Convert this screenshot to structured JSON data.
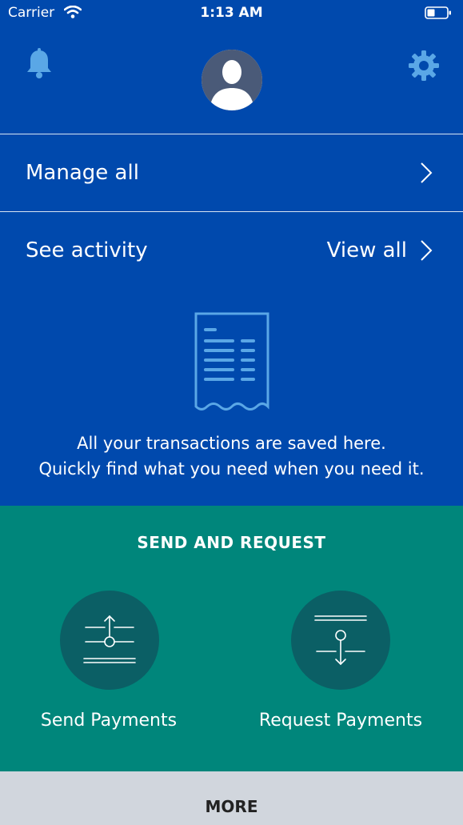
{
  "status_bar": {
    "carrier": "Carrier",
    "time": "1:13 AM"
  },
  "header": {
    "icons": [
      "bell-icon",
      "avatar",
      "gear-icon"
    ]
  },
  "rows": {
    "manage": {
      "label": "Manage all"
    },
    "activity": {
      "label": "See activity",
      "link": "View all"
    }
  },
  "empty_state": {
    "line1": "All your transactions are saved here.",
    "line2": "Quickly find what you need when you need it."
  },
  "send_request": {
    "title": "SEND AND REQUEST",
    "send_label": "Send Payments",
    "request_label": "Request Payments"
  },
  "more": {
    "label": "MORE"
  },
  "colors": {
    "primary_blue": "#0049ad",
    "teal": "#00867b",
    "circle": "#0b5f65",
    "icon_blue": "#5aa7e6",
    "more_bar": "#d1d6dd"
  }
}
